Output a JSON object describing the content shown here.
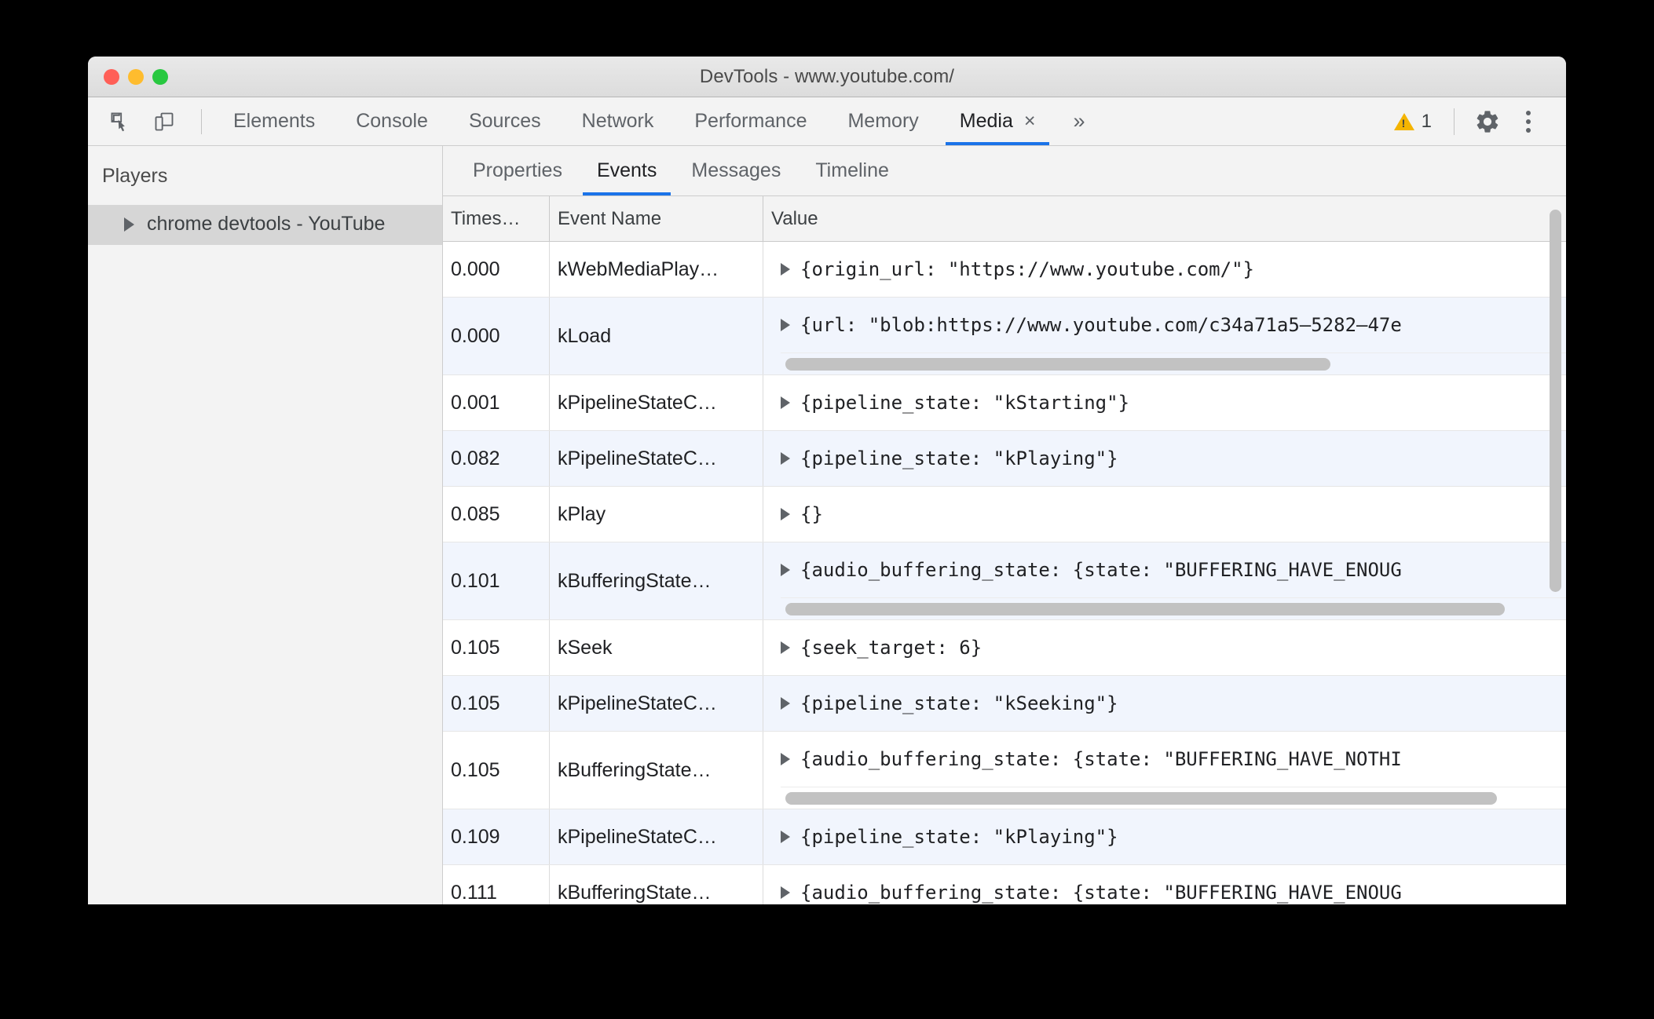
{
  "window": {
    "title": "DevTools - www.youtube.com/",
    "traffic_lights": [
      "close",
      "minimize",
      "maximize"
    ]
  },
  "toolbar": {
    "inspect_icon": "inspect-element-icon",
    "device_icon": "device-toolbar-icon",
    "tabs": [
      {
        "label": "Elements",
        "active": false,
        "closable": false
      },
      {
        "label": "Console",
        "active": false,
        "closable": false
      },
      {
        "label": "Sources",
        "active": false,
        "closable": false
      },
      {
        "label": "Network",
        "active": false,
        "closable": false
      },
      {
        "label": "Performance",
        "active": false,
        "closable": false
      },
      {
        "label": "Memory",
        "active": false,
        "closable": false
      },
      {
        "label": "Media",
        "active": true,
        "closable": true
      }
    ],
    "close_glyph": "×",
    "more_tabs_glyph": "»",
    "warning_count": "1",
    "settings_icon": "gear-icon",
    "more_options_icon": "kebab-menu-icon",
    "accent_color": "#1a73e8",
    "warning_color": "#f4b400"
  },
  "sidebar": {
    "title": "Players",
    "items": [
      {
        "label": "chrome devtools - YouTube",
        "selected": true,
        "expanded": false
      }
    ]
  },
  "panel": {
    "subtabs": [
      {
        "label": "Properties",
        "active": false
      },
      {
        "label": "Events",
        "active": true
      },
      {
        "label": "Messages",
        "active": false
      },
      {
        "label": "Timeline",
        "active": false
      }
    ],
    "table": {
      "columns": [
        "Times…",
        "Event Name",
        "Value"
      ],
      "rows": [
        {
          "timestamp": "0.000",
          "event_name": "kWebMediaPlay…",
          "value": "{origin_url: \"https://www.youtube.com/\"}",
          "expandable": true,
          "has_hscroll": false,
          "striped": false
        },
        {
          "timestamp": "0.000",
          "event_name": "kLoad",
          "value": "{url: \"blob:https://www.youtube.com/c34a71a5–5282–47e",
          "expandable": true,
          "has_hscroll": true,
          "hscroll_percent": 72,
          "striped": true
        },
        {
          "timestamp": "0.001",
          "event_name": "kPipelineStateC…",
          "value": "{pipeline_state: \"kStarting\"}",
          "expandable": true,
          "has_hscroll": false,
          "striped": false
        },
        {
          "timestamp": "0.082",
          "event_name": "kPipelineStateC…",
          "value": "{pipeline_state: \"kPlaying\"}",
          "expandable": true,
          "has_hscroll": false,
          "striped": true
        },
        {
          "timestamp": "0.085",
          "event_name": "kPlay",
          "value": "{}",
          "expandable": true,
          "has_hscroll": false,
          "striped": false
        },
        {
          "timestamp": "0.101",
          "event_name": "kBufferingState…",
          "value": "{audio_buffering_state: {state: \"BUFFERING_HAVE_ENOUG",
          "expandable": true,
          "has_hscroll": true,
          "hscroll_percent": 95,
          "striped": true
        },
        {
          "timestamp": "0.105",
          "event_name": "kSeek",
          "value": "{seek_target: 6}",
          "expandable": true,
          "has_hscroll": false,
          "striped": false
        },
        {
          "timestamp": "0.105",
          "event_name": "kPipelineStateC…",
          "value": "{pipeline_state: \"kSeeking\"}",
          "expandable": true,
          "has_hscroll": false,
          "striped": true
        },
        {
          "timestamp": "0.105",
          "event_name": "kBufferingState…",
          "value": "{audio_buffering_state: {state: \"BUFFERING_HAVE_NOTHI",
          "expandable": true,
          "has_hscroll": true,
          "hscroll_percent": 94,
          "striped": false
        },
        {
          "timestamp": "0.109",
          "event_name": "kPipelineStateC…",
          "value": "{pipeline_state: \"kPlaying\"}",
          "expandable": true,
          "has_hscroll": false,
          "striped": true
        },
        {
          "timestamp": "0.111",
          "event_name": "kBufferingState…",
          "value": "{audio_buffering_state: {state: \"BUFFERING_HAVE_ENOUG",
          "expandable": true,
          "has_hscroll": false,
          "striped": false
        }
      ]
    },
    "vertical_scroll": {
      "thumb_top_percent": 1,
      "thumb_height_percent": 55
    }
  }
}
